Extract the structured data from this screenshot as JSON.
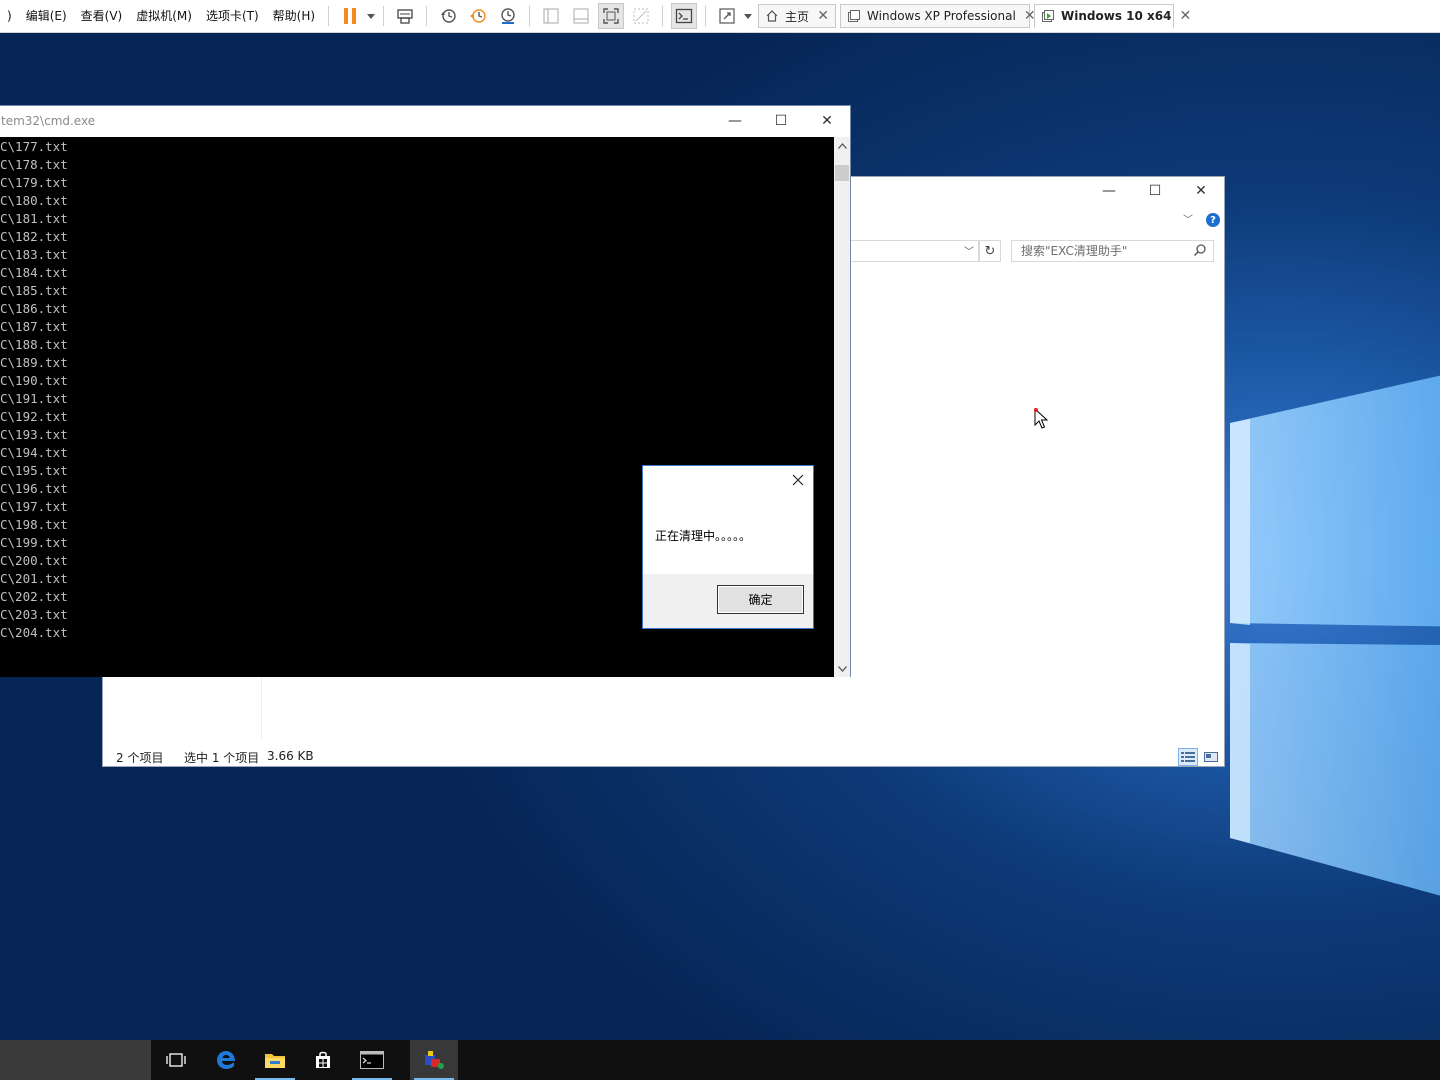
{
  "vmware": {
    "menu": [
      {
        "label": ")"
      },
      {
        "label": "编辑(E)"
      },
      {
        "label": "查看(V)"
      },
      {
        "label": "虚拟机(M)"
      },
      {
        "label": "选项卡(T)"
      },
      {
        "label": "帮助(H)"
      }
    ],
    "toolbar_icons": [
      "pause-icon",
      "dropdown-arrow-icon",
      "send-ctrl-alt-del-icon",
      "snapshot-icon",
      "revert-snapshot-icon",
      "snapshot-manager-icon",
      "console-view-icon",
      "thumbnail-bar-icon",
      "full-screen-icon",
      "unity-icon",
      "terminal-icon",
      "stretch-icon",
      "dropdown-arrow-icon"
    ],
    "tabs": [
      {
        "label": "主页",
        "icon": "home-icon",
        "active": false
      },
      {
        "label": "Windows XP Professional",
        "icon": "vm-icon",
        "active": false
      },
      {
        "label": "Windows 10 x64",
        "icon": "vm-running-icon",
        "active": true
      }
    ],
    "accent_color": "#f28c1c"
  },
  "explorer": {
    "search_placeholder": "搜索\"EXC清理助手\"",
    "status_items": "2 个项目",
    "status_selected": "选中 1 个项目",
    "status_size": "3.66 KB"
  },
  "cmd": {
    "title": "tem32\\cmd.exe",
    "lines": [
      "C\\177.txt",
      "C\\178.txt",
      "C\\179.txt",
      "C\\180.txt",
      "C\\181.txt",
      "C\\182.txt",
      "C\\183.txt",
      "C\\184.txt",
      "C\\185.txt",
      "C\\186.txt",
      "C\\187.txt",
      "C\\188.txt",
      "C\\189.txt",
      "C\\190.txt",
      "C\\191.txt",
      "C\\192.txt",
      "C\\193.txt",
      "C\\194.txt",
      "C\\195.txt",
      "C\\196.txt",
      "C\\197.txt",
      "C\\198.txt",
      "C\\199.txt",
      "C\\200.txt",
      "C\\201.txt",
      "C\\202.txt",
      "C\\203.txt",
      "C\\204.txt"
    ]
  },
  "msgbox": {
    "message": "正在清理中。。。。。",
    "ok_label": "确定"
  },
  "taskbar": {
    "apps": [
      "task-view-icon",
      "edge-icon",
      "file-explorer-icon",
      "store-icon",
      "cmd-icon",
      "custom-app-icon"
    ]
  },
  "colors": {
    "desktop_blue": "#0d3a78",
    "taskbar": "#101010",
    "dialog_border": "#3d78c9",
    "help_blue": "#1a6fd0"
  }
}
